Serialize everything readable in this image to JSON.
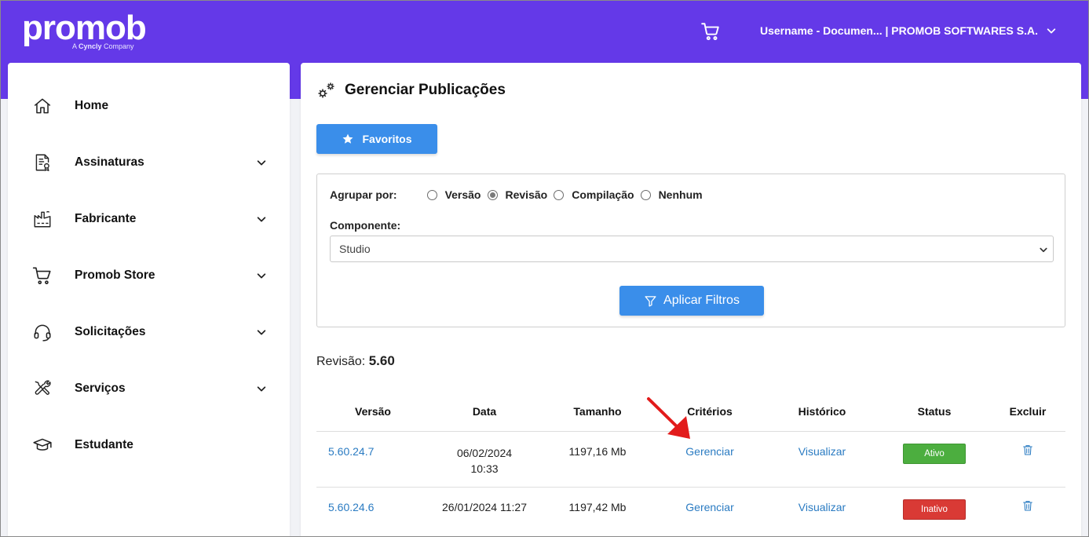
{
  "brand": {
    "logo_text": "promob",
    "tagline_prefix": "A ",
    "tagline_brand": "Cyncly",
    "tagline_suffix": " Company"
  },
  "header": {
    "cart_icon": "cart-icon",
    "user_label": "Username - Documen... | PROMOB SOFTWARES S.A."
  },
  "sidebar": {
    "items": [
      {
        "label": "Home",
        "icon": "home-icon",
        "expandable": false
      },
      {
        "label": "Assinaturas",
        "icon": "certificate-document-icon",
        "expandable": true
      },
      {
        "label": "Fabricante",
        "icon": "factory-icon",
        "expandable": true
      },
      {
        "label": "Promob Store",
        "icon": "cart-icon",
        "expandable": true
      },
      {
        "label": "Solicitações",
        "icon": "headset-icon",
        "expandable": true
      },
      {
        "label": "Serviços",
        "icon": "tools-icon",
        "expandable": true
      },
      {
        "label": "Estudante",
        "icon": "graduation-cap-icon",
        "expandable": false
      }
    ]
  },
  "page": {
    "title": "Gerenciar Publicações",
    "favorites_label": "Favoritos"
  },
  "filters": {
    "group_by_label": "Agrupar por:",
    "group_options": [
      "Versão",
      "Revisão",
      "Compilação",
      "Nenhum"
    ],
    "group_selected": "Revisão",
    "component_label": "Componente:",
    "component_value": "Studio",
    "apply_label": "Aplicar Filtros"
  },
  "revision": {
    "label": "Revisão:",
    "value": "5.60"
  },
  "table": {
    "headers": [
      "Versão",
      "Data",
      "Tamanho",
      "Critérios",
      "Histórico",
      "Status",
      "Excluir"
    ],
    "rows": [
      {
        "version": "5.60.24.7",
        "date_line1": "06/02/2024",
        "date_line2": "10:33",
        "size": "1197,16 Mb",
        "criteria": "Gerenciar",
        "history": "Visualizar",
        "status": "Ativo",
        "status_color": "#4cae3f"
      },
      {
        "version": "5.60.24.6",
        "date_line1": "26/01/2024 11:27",
        "date_line2": "",
        "size": "1197,42 Mb",
        "criteria": "Gerenciar",
        "history": "Visualizar",
        "status": "Inativo",
        "status_color": "#d93a35"
      }
    ]
  },
  "colors": {
    "brand_purple": "#6439e8",
    "button_blue": "#3a8eea",
    "link_blue": "#2a7bc2",
    "annotation_red": "#e21b1b"
  }
}
